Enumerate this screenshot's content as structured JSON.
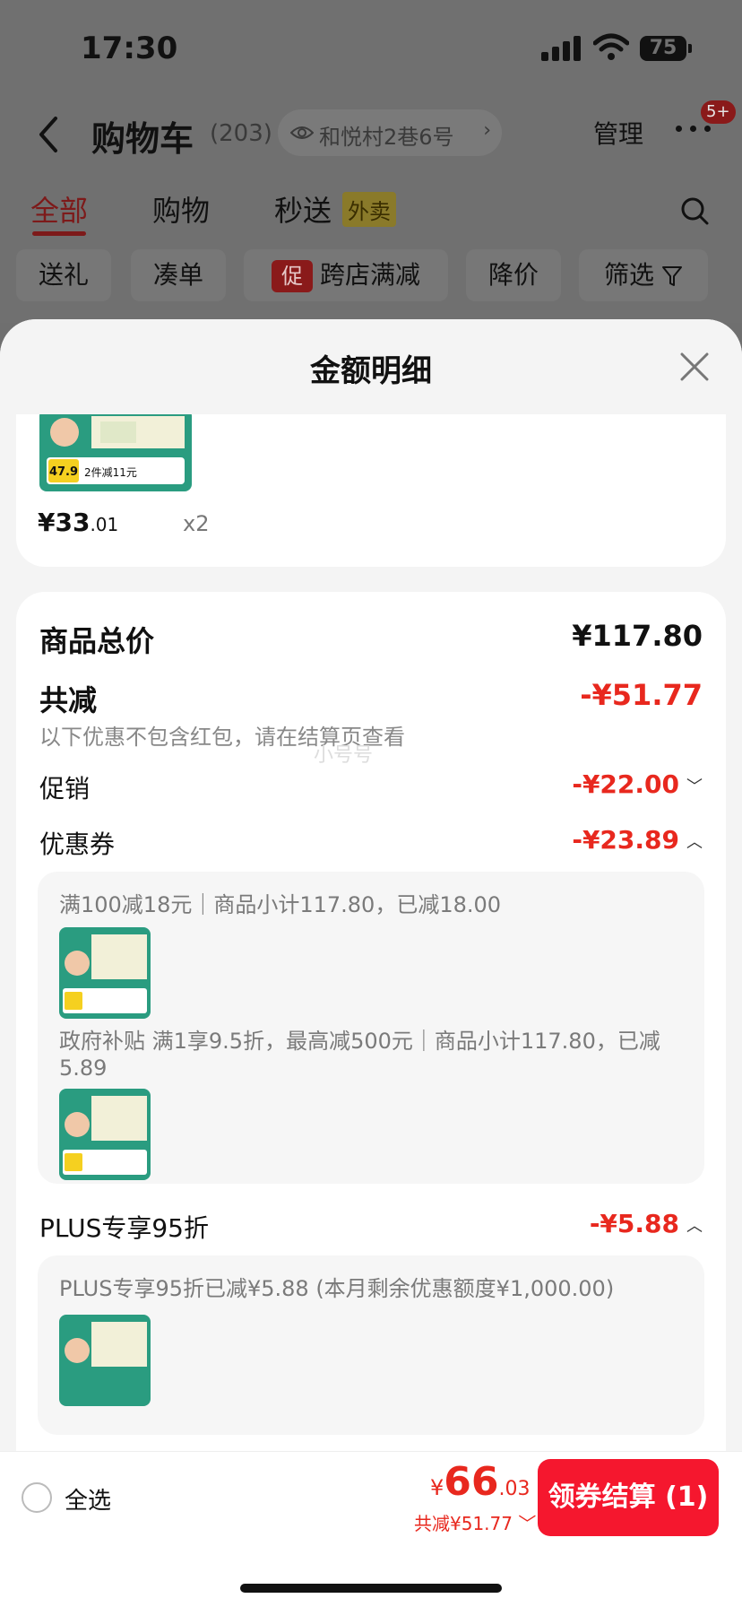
{
  "status": {
    "time": "17:30",
    "battery": "75"
  },
  "nav": {
    "title": "购物车",
    "count": "(203)",
    "address": "和悦村2巷6号",
    "manage": "管理",
    "badge": "5+"
  },
  "tabs": [
    {
      "label": "全部",
      "active": true
    },
    {
      "label": "购物"
    },
    {
      "label": "秒送"
    }
  ],
  "waimai_tag": "外卖",
  "filters": {
    "gift": "送礼",
    "collect": "凑单",
    "promo_icon": "促",
    "cross_store": "跨店满减",
    "price_drop": "降价",
    "filter": "筛选"
  },
  "sheet": {
    "title": "金额明细",
    "item": {
      "price_int": "¥33",
      "price_dec": ".01",
      "qty": "x2"
    },
    "product_image_text": {
      "badge": "47.9",
      "promo": "2件减11元"
    },
    "watermark": "小号号",
    "total_label": "商品总价",
    "total_value": "¥117.80",
    "discount_label": "共减",
    "discount_value": "-¥51.77",
    "discount_note": "以下优惠不包含红包，请在结算页查看",
    "promo_label": "促销",
    "promo_value": "-¥22.00",
    "coupon_label": "优惠券",
    "coupon_value": "-¥23.89",
    "coupon_details": [
      "满100减18元｜商品小计117.80，已减18.00",
      "政府补贴 满1享9.5折，最高减500元｜商品小计117.80，已减5.89"
    ],
    "plus_label": "PLUS专享95折",
    "plus_value": "-¥5.88",
    "plus_detail": "PLUS专享95折已减¥5.88 (本月剩余优惠额度¥1,000.00)"
  },
  "checkout": {
    "select_all": "全选",
    "total_yen": "¥",
    "total_int": "66",
    "total_dec": ".03",
    "total_sub": "共减¥51.77",
    "button": "领券结算 (1)"
  },
  "colors": {
    "accent": "#e8281e",
    "button": "#f5172e"
  }
}
